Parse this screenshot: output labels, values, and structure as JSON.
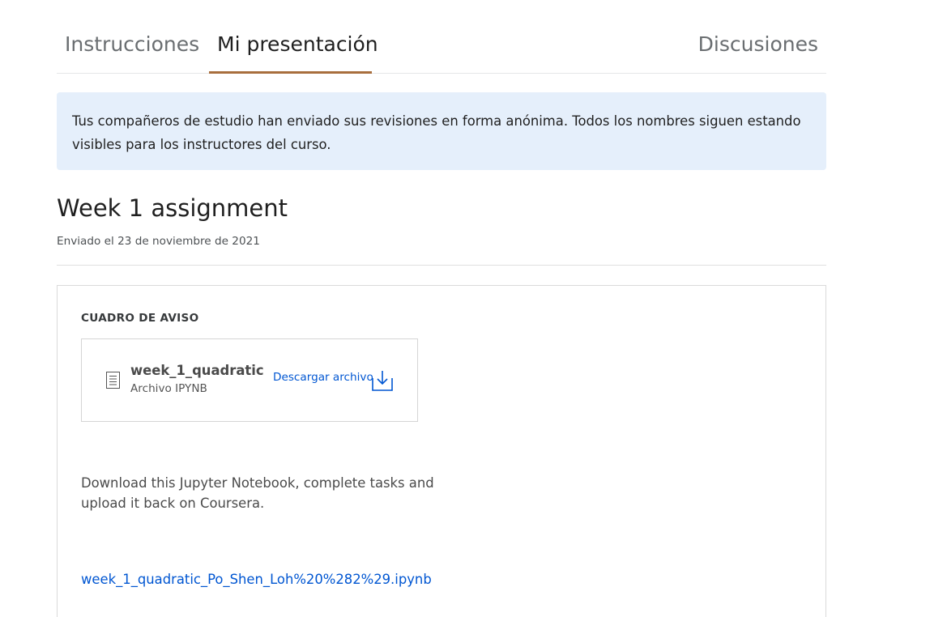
{
  "tabs": [
    {
      "label": "Instrucciones"
    },
    {
      "label": "Mi presentación"
    },
    {
      "label": "Discusiones"
    }
  ],
  "notice": {
    "text": "Tus compañeros de estudio han enviado sus revisiones en forma anónima. Todos los nombres siguen estando visibles para los instructores del curso."
  },
  "assignment": {
    "title": "Week 1 assignment",
    "submitted": "Enviado el 23 de noviembre de 2021"
  },
  "card": {
    "section_label": "CUADRO DE AVISO",
    "file": {
      "name": "week_1_quadratic",
      "type": "Archivo IPYNB",
      "download_label": "Descargar archivo",
      "icon": "document-icon"
    },
    "description": "Download this Jupyter Notebook, complete tasks and upload it back on Coursera.",
    "link": "week_1_quadratic_Po_Shen_Loh%20%282%29.ipynb"
  },
  "colors": {
    "accent": "#a86e3d",
    "link": "#0056d2",
    "notice_bg": "#e5effb"
  }
}
